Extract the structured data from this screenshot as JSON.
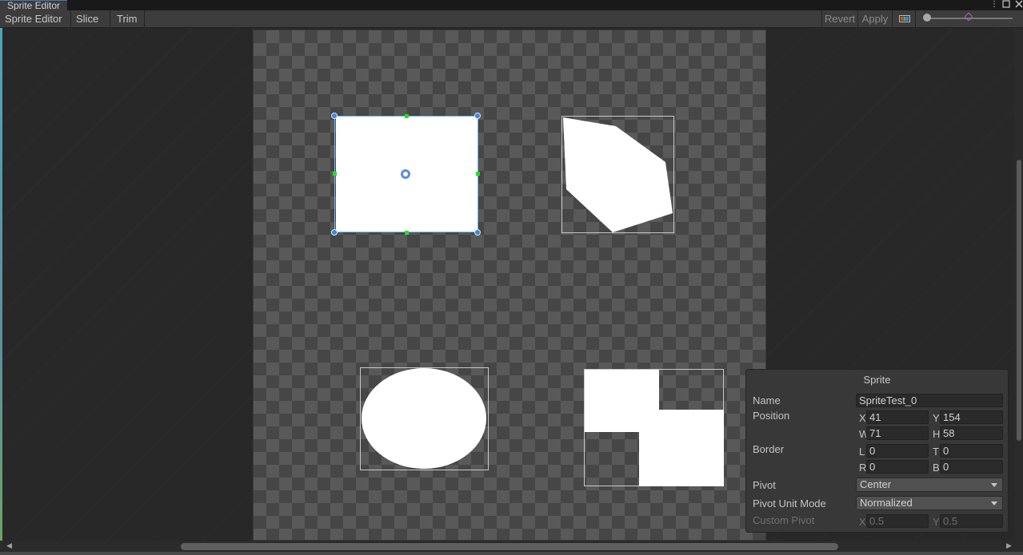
{
  "window": {
    "title": "Sprite Editor"
  },
  "toolbar": {
    "mode_label": "Sprite Editor",
    "slice_label": "Slice",
    "trim_label": "Trim",
    "revert_label": "Revert",
    "apply_label": "Apply"
  },
  "inspector": {
    "title": "Sprite",
    "name_label": "Name",
    "name_value": "SpriteTest_0",
    "position_label": "Position",
    "x_label": "X",
    "x_value": "41",
    "y_label": "Y",
    "y_value": "154",
    "w_label": "W",
    "w_value": "71",
    "h_label": "H",
    "h_value": "58",
    "border_label": "Border",
    "l_label": "L",
    "l_value": "0",
    "t_label": "T",
    "t_value": "0",
    "r_label": "R",
    "r_value": "0",
    "b_label": "B",
    "b_value": "0",
    "pivot_label": "Pivot",
    "pivot_value": "Center",
    "pivot_unit_label": "Pivot Unit Mode",
    "pivot_unit_value": "Normalized",
    "custom_pivot_label": "Custom Pivot",
    "cp_x_label": "X",
    "cp_x_value": "0.5",
    "cp_y_label": "Y",
    "cp_y_value": "0.5"
  },
  "icons": {
    "menu": "more-vertical-icon",
    "maximize": "maximize-icon",
    "close": "close-icon",
    "color_channel": "rgb-channel-icon"
  }
}
